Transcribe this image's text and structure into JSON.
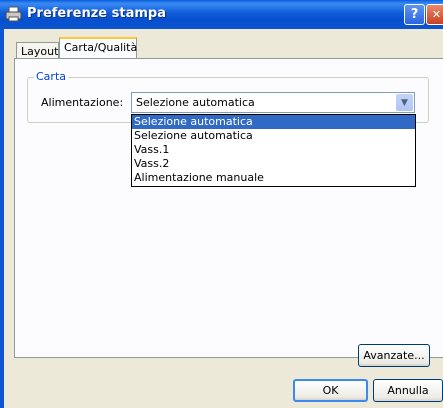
{
  "window": {
    "title": "Preferenze stampa"
  },
  "titlebar": {
    "help_label": "?",
    "close_label": "✕"
  },
  "tabs": [
    {
      "label": "Layout"
    },
    {
      "label": "Carta/Qualità"
    }
  ],
  "carta_group": {
    "title": "Carta",
    "source_label": "Alimentazione:",
    "source_value": "Selezione automatica",
    "options": [
      "Selezione automatica",
      "Selezione automatica",
      "Vass.1",
      "Vass.2",
      "Alimentazione manuale"
    ],
    "selected_index": 0
  },
  "buttons": {
    "advanced": "Avanzate...",
    "ok": "OK",
    "cancel": "Annulla"
  }
}
